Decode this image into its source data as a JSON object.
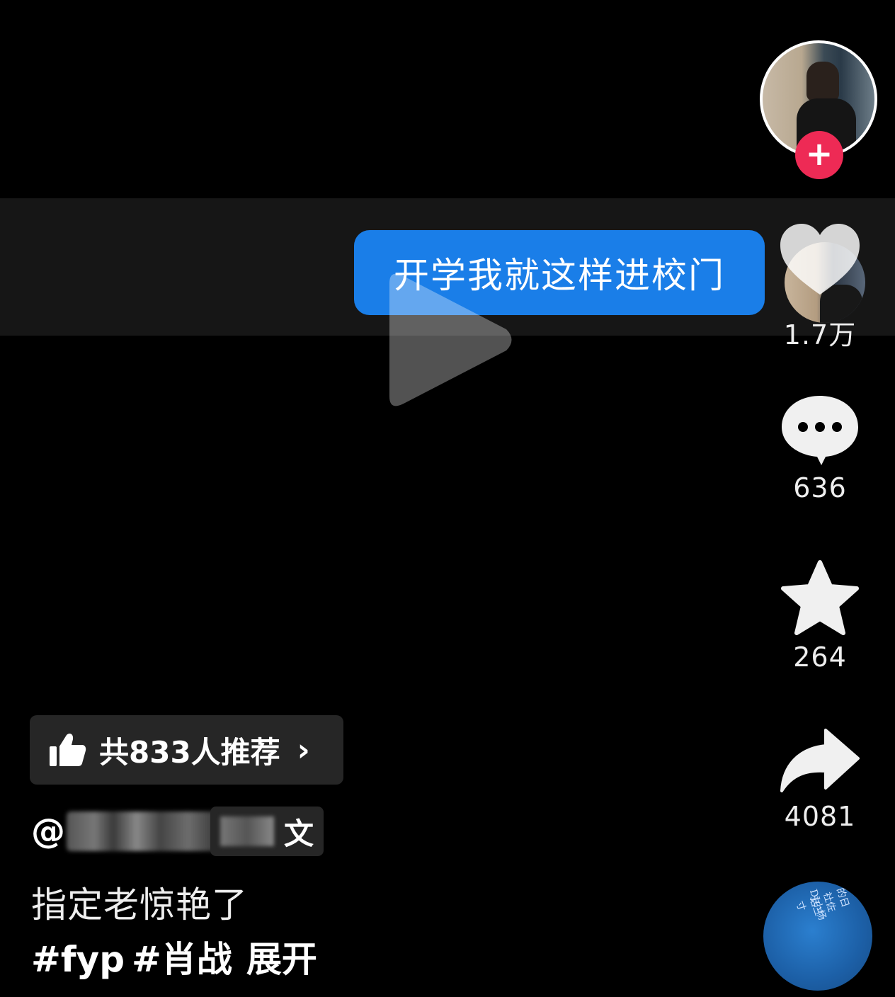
{
  "video": {
    "overlay_text": "开学我就这样进校门"
  },
  "rail": {
    "likes": "1.7万",
    "comments": "636",
    "favorites": "264",
    "shares": "4081",
    "follow_symbol": "+"
  },
  "recommend": {
    "label": "共833人推荐",
    "chevron": "›"
  },
  "author": {
    "at": "@",
    "chip_label": "文"
  },
  "caption": "指定老惊艳了",
  "hashtags": [
    "#fyp",
    "#肖战"
  ],
  "expand_label": "展开",
  "music_disc": {
    "text_1": "DJ小杨",
    "text_2": "的日社佐话三寸"
  },
  "colors": {
    "bubble": "#1a7ee8",
    "follow": "#ee2a55",
    "background": "#000000",
    "chip": "#262626"
  },
  "icons": [
    "play-icon",
    "heart-icon",
    "comment-icon",
    "star-icon",
    "share-icon",
    "thumbs-up-icon",
    "plus-icon"
  ]
}
